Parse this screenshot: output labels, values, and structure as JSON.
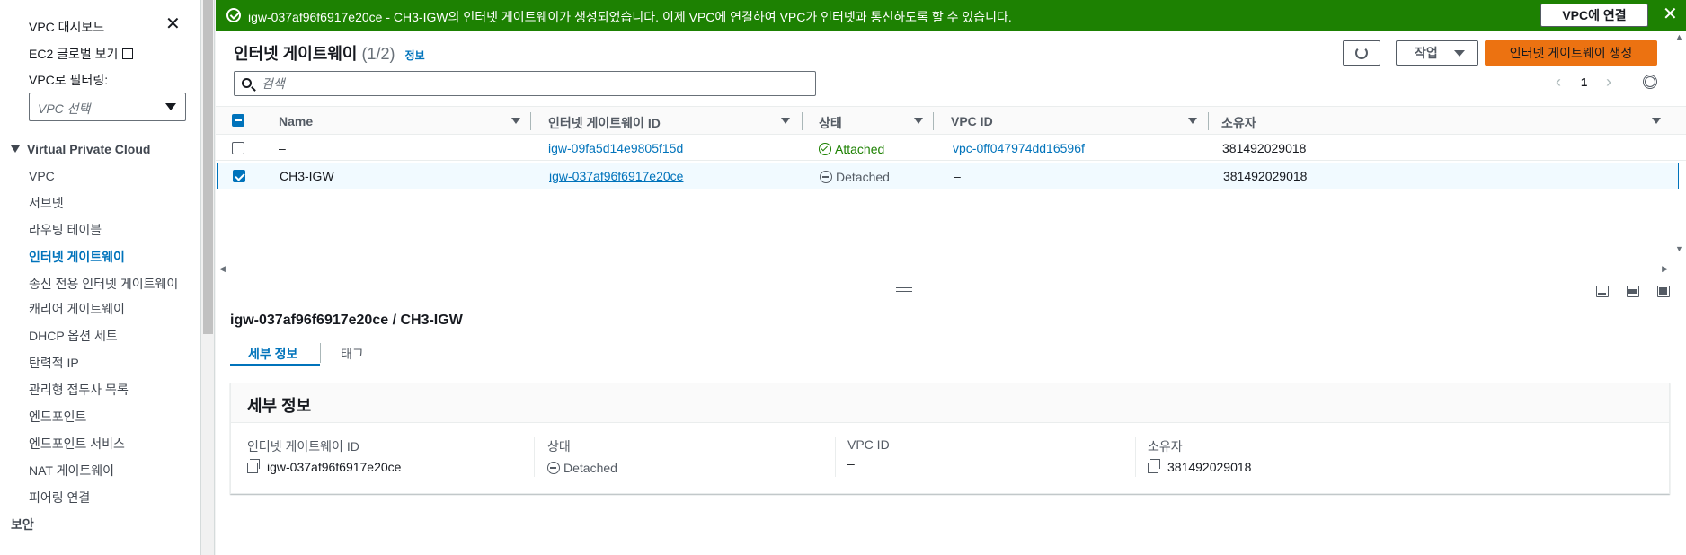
{
  "sidebar": {
    "dashboard": "VPC 대시보드",
    "ec2_global": "EC2 글로벌 보기",
    "filter_label": "VPC로 필터링:",
    "filter_placeholder": "VPC 선택",
    "section": "Virtual Private Cloud",
    "items": [
      {
        "label": "VPC"
      },
      {
        "label": "서브넷"
      },
      {
        "label": "라우팅 테이블"
      },
      {
        "label": "인터넷 게이트웨이"
      },
      {
        "label": "송신 전용 인터넷 게이트웨이"
      },
      {
        "label": "캐리어 게이트웨이"
      },
      {
        "label": "DHCP 옵션 세트"
      },
      {
        "label": "탄력적 IP"
      },
      {
        "label": "관리형 접두사 목록"
      },
      {
        "label": "엔드포인트"
      },
      {
        "label": "엔드포인트 서비스"
      },
      {
        "label": "NAT 게이트웨이"
      },
      {
        "label": "피어링 연결"
      },
      {
        "label": "보안"
      }
    ]
  },
  "flash": {
    "message": "igw-037af96f6917e20ce - CH3-IGW의 인터넷 게이트웨이가 생성되었습니다. 이제 VPC에 연결하여 VPC가 인터넷과 통신하도록 할 수 있습니다.",
    "button": "VPC에 연결",
    "color": "#1d8102"
  },
  "table": {
    "title": "인터넷 게이트웨이",
    "count": "(1/2)",
    "info": "정보",
    "actions_label": "작업",
    "create_label": "인터넷 게이트웨이 생성",
    "create_color": "#ec7211",
    "search_placeholder": "검색",
    "page": "1",
    "columns": [
      "Name",
      "인터넷 게이트웨이 ID",
      "상태",
      "VPC ID",
      "소유자"
    ],
    "rows": [
      {
        "name": "–",
        "id": "igw-09fa5d14e9805f15d",
        "state": "Attached",
        "vpc": "vpc-0ff047974dd16596f",
        "owner": "381492029018",
        "selected": false
      },
      {
        "name": "CH3-IGW",
        "id": "igw-037af96f6917e20ce",
        "state": "Detached",
        "vpc": "–",
        "owner": "381492029018",
        "selected": true
      }
    ]
  },
  "detail": {
    "title": "igw-037af96f6917e20ce / CH3-IGW",
    "tabs": [
      "세부 정보",
      "태그"
    ],
    "card_title": "세부 정보",
    "fields": [
      {
        "label": "인터넷 게이트웨이 ID",
        "value": "igw-037af96f6917e20ce"
      },
      {
        "label": "상태",
        "value": "Detached"
      },
      {
        "label": "VPC ID",
        "value": "–"
      },
      {
        "label": "소유자",
        "value": "381492029018"
      }
    ]
  }
}
